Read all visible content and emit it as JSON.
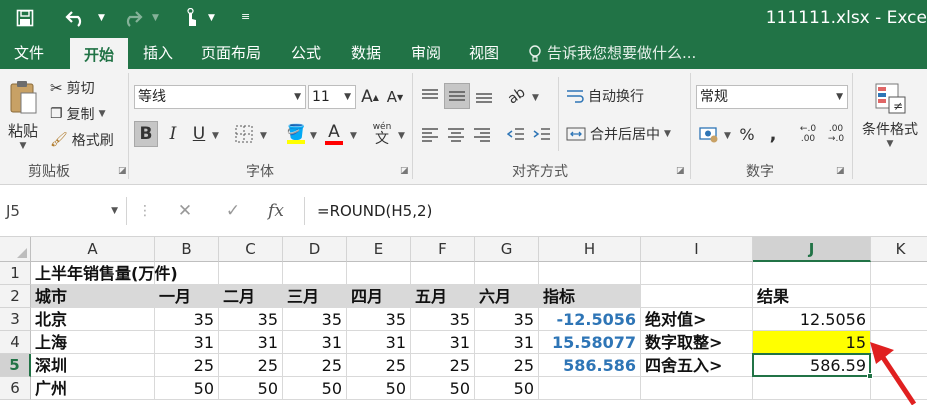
{
  "window": {
    "file_title": "111111.xlsx - Exce"
  },
  "menu": {
    "tabs": [
      "文件",
      "开始",
      "插入",
      "页面布局",
      "公式",
      "数据",
      "审阅",
      "视图"
    ],
    "active": "开始",
    "tell_me": "告诉我您想要做什么..."
  },
  "ribbon": {
    "clipboard": {
      "paste": "粘贴",
      "cut": "剪切",
      "copy": "复制",
      "format_painter": "格式刷",
      "label": "剪贴板"
    },
    "font": {
      "name": "等线",
      "size": "11",
      "grow": "A",
      "shrink": "A",
      "bold": "B",
      "italic": "I",
      "underline": "U",
      "font_color_letter": "A",
      "wen": "wén",
      "wen_char": "文",
      "label": "字体"
    },
    "alignment": {
      "wrap_text": "自动换行",
      "merge_center": "合并后居中",
      "label": "对齐方式"
    },
    "number": {
      "format": "常规",
      "percent": "%",
      "comma": ",",
      "inc_decimal": "←.0 .00",
      "dec_decimal": ".00 →.0",
      "label": "数字"
    },
    "styles": {
      "conditional": "条件格式"
    },
    "colors": {
      "brand": "#217346",
      "ribbon_bg": "#f3f3f3",
      "font_color_bar": "#ff0000",
      "highlight": "#ffff00",
      "arrow": "#e02020"
    }
  },
  "formula_bar": {
    "name_box": "J5",
    "cancel": "✕",
    "enter": "✓",
    "fx": "fx",
    "formula": "=ROUND(H5,2)"
  },
  "sheet": {
    "columns": [
      "A",
      "B",
      "C",
      "D",
      "E",
      "F",
      "G",
      "H",
      "I",
      "J",
      "K"
    ],
    "selected_column": "J",
    "selected_row": "5",
    "rows": [
      {
        "num": "1",
        "A": "上半年销售量(万件)"
      },
      {
        "num": "2",
        "A": "城市",
        "B": "一月",
        "C": "二月",
        "D": "三月",
        "E": "四月",
        "F": "五月",
        "G": "六月",
        "H": "指标",
        "J": "结果"
      },
      {
        "num": "3",
        "A": "北京",
        "B": "35",
        "C": "35",
        "D": "35",
        "E": "35",
        "F": "35",
        "G": "35",
        "H": "-12.5056",
        "I": "绝对值>",
        "J": "12.5056"
      },
      {
        "num": "4",
        "A": "上海",
        "B": "31",
        "C": "31",
        "D": "31",
        "E": "31",
        "F": "31",
        "G": "31",
        "H": "15.58077",
        "I": "数字取整>",
        "J": "15"
      },
      {
        "num": "5",
        "A": "深圳",
        "B": "25",
        "C": "25",
        "D": "25",
        "E": "25",
        "F": "25",
        "G": "25",
        "H": "586.586",
        "I": "四舍五入>",
        "J": "586.59"
      },
      {
        "num": "6",
        "A": "广州",
        "B": "50",
        "C": "50",
        "D": "50",
        "E": "50",
        "F": "50",
        "G": "50"
      }
    ]
  }
}
